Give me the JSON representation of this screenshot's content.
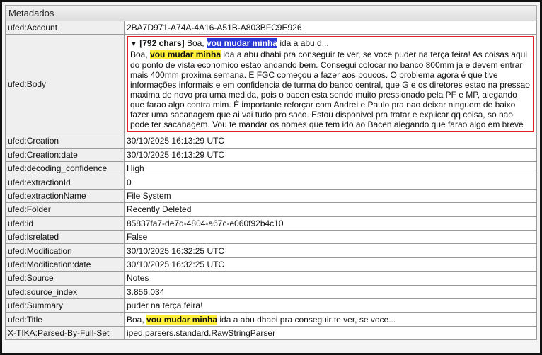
{
  "panel": {
    "title": "Metadados"
  },
  "rows": {
    "account": {
      "key": "ufed:Account",
      "value": "2BA7D971-A74A-4A16-A51B-A803BFC9E926"
    },
    "body": {
      "key": "ufed:Body",
      "summary_toggle": "▼",
      "summary_count": "[792 chars]",
      "summary_pre": " Boa, ",
      "summary_hl": "vou mudar minha",
      "summary_post": " ida a abu d...",
      "text_pre": "Boa, ",
      "text_hl": "vou mudar minha",
      "text_post": " ida a abu dhabi pra conseguir te ver, se voce puder na terça feira! As coisas aqui do ponto de vista economico estao andando bem. Consegui colocar no banco 800mm ja e devem entrar mais 400mm proxima semana. E FGC começou a fazer aos poucos. O problema agora é que tive informações informais e em confidencia de turma do banco central, que G e os diretores estao na pressao maxima de novo pra uma medida, pois o bacen esta sendo muito pressionado pela PF e MP, alegando que farao algo contra mim. É importante reforçar com Andrei e Paulo pra nao deixar ninguem de baixo fazer uma sacanagem que ai vai tudo pro saco. Estou disponivel pra tratar e explicar qq coisa, so nao pode ter sacanagem. Vou te mandar os nomes que tem ido ao Bacen alegando que farao algo em breve"
    },
    "creation": {
      "key": "ufed:Creation",
      "value": "30/10/2025 16:13:29 UTC"
    },
    "creation_date": {
      "key": "ufed:Creation:date",
      "value": "30/10/2025 16:13:29 UTC"
    },
    "decoding_confidence": {
      "key": "ufed:decoding_confidence",
      "value": "High"
    },
    "extraction_id": {
      "key": "ufed:extractionId",
      "value": "0"
    },
    "extraction_name": {
      "key": "ufed:extractionName",
      "value": "File System"
    },
    "folder": {
      "key": "ufed:Folder",
      "value": "Recently Deleted"
    },
    "id": {
      "key": "ufed:id",
      "value": "85837fa7-de7d-4804-a67c-e060f92b4c10"
    },
    "isrelated": {
      "key": "ufed:isrelated",
      "value": "False"
    },
    "modification": {
      "key": "ufed:Modification",
      "value": "30/10/2025 16:32:25 UTC"
    },
    "modification_date": {
      "key": "ufed:Modification:date",
      "value": "30/10/2025 16:32:25 UTC"
    },
    "source": {
      "key": "ufed:Source",
      "value": "Notes"
    },
    "source_index": {
      "key": "ufed:source_index",
      "value": "3.856.034"
    },
    "summary": {
      "key": "ufed:Summary",
      "value": "puder na terça feira!"
    },
    "title": {
      "key": "ufed:Title",
      "value_pre": "Boa, ",
      "value_hl": "vou mudar minha",
      "value_post": " ida a abu dhabi pra conseguir te ver, se voce..."
    },
    "parsed_by": {
      "key": "X-TIKA:Parsed-By-Full-Set",
      "value": "iped.parsers.standard.RawStringParser"
    }
  },
  "colors": {
    "highlight_yellow": "#ffef3a",
    "highlight_blue": "#2a3bd6",
    "body_border_red": "#e0202a"
  }
}
